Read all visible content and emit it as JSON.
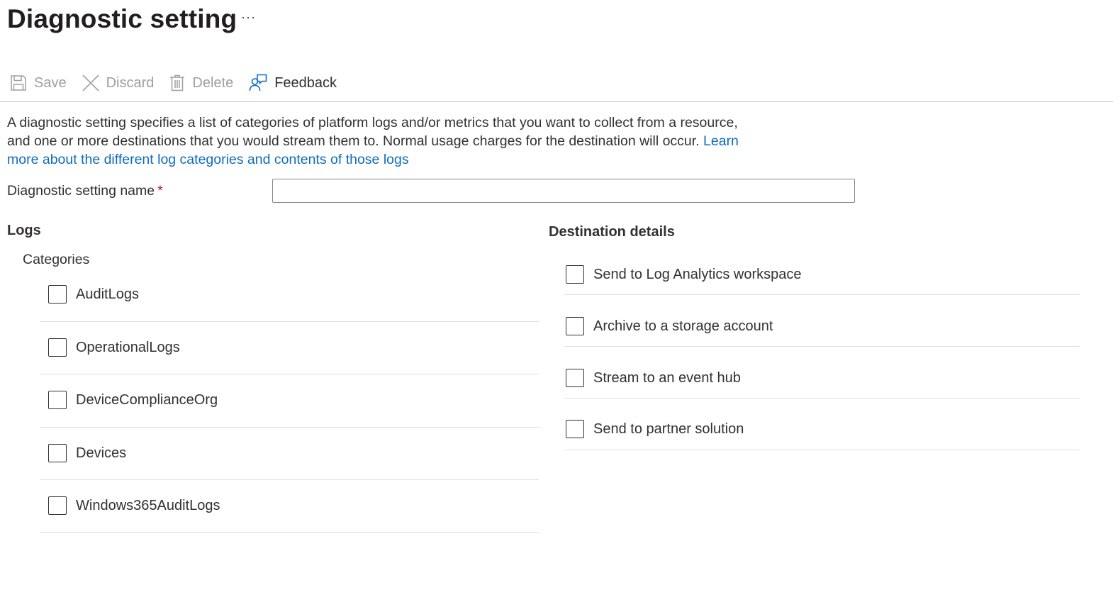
{
  "page": {
    "title": "Diagnostic setting",
    "more_label": "···"
  },
  "toolbar": {
    "save_label": "Save",
    "discard_label": "Discard",
    "delete_label": "Delete",
    "feedback_label": "Feedback",
    "save_icon": "save-icon",
    "discard_icon": "close-icon",
    "delete_icon": "trash-icon",
    "feedback_icon": "feedback-icon"
  },
  "description": {
    "text": "A diagnostic setting specifies a list of categories of platform logs and/or metrics that you want to collect from a resource, and one or more destinations that you would stream them to. Normal usage charges for the destination will occur.",
    "link_text": "Learn more about the different log categories and contents of those logs"
  },
  "form": {
    "name_label": "Diagnostic setting name",
    "required_marker": "*",
    "name_value": "",
    "name_placeholder": ""
  },
  "logs": {
    "heading": "Logs",
    "categories_label": "Categories",
    "items": [
      {
        "label": "AuditLogs",
        "checked": false
      },
      {
        "label": "OperationalLogs",
        "checked": false
      },
      {
        "label": "DeviceComplianceOrg",
        "checked": false
      },
      {
        "label": "Devices",
        "checked": false
      },
      {
        "label": "Windows365AuditLogs",
        "checked": false
      }
    ]
  },
  "destination": {
    "heading": "Destination details",
    "items": [
      {
        "label": "Send to Log Analytics workspace",
        "checked": false
      },
      {
        "label": "Archive to a storage account",
        "checked": false
      },
      {
        "label": "Stream to an event hub",
        "checked": false
      },
      {
        "label": "Send to partner solution",
        "checked": false
      }
    ]
  },
  "colors": {
    "link": "#0f6cbd",
    "text": "#323130",
    "disabled": "#a19f9d",
    "required": "#a4262c",
    "divider": "#e1dfdd"
  }
}
